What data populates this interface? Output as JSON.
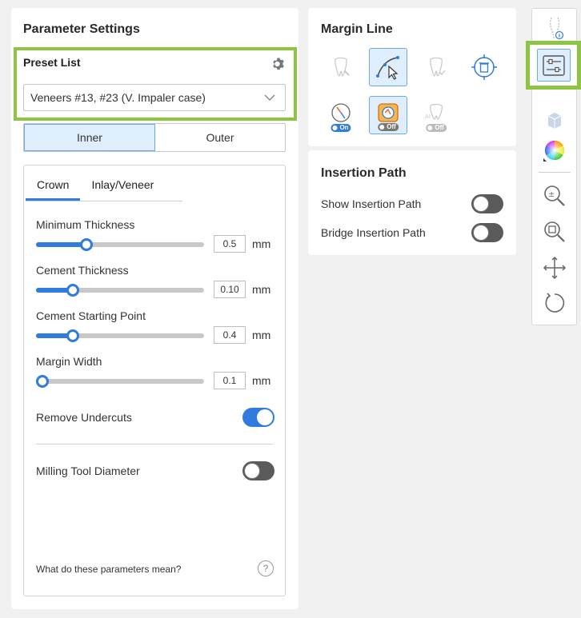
{
  "parameter_settings": {
    "title": "Parameter Settings",
    "preset": {
      "label": "Preset List",
      "selected": "Veneers #13, #23 (V. Impaler case)"
    },
    "side_tabs": [
      "Inner",
      "Outer"
    ],
    "active_side_tab": "Inner",
    "sub_tabs": [
      "Crown",
      "Inlay/Veneer"
    ],
    "active_sub_tab": "Crown",
    "params": [
      {
        "label": "Minimum Thickness",
        "value": "0.5",
        "unit": "mm",
        "fraction": 0.3
      },
      {
        "label": "Cement Thickness",
        "value": "0.10",
        "unit": "mm",
        "fraction": 0.22
      },
      {
        "label": "Cement Starting Point",
        "value": "0.4",
        "unit": "mm",
        "fraction": 0.22
      },
      {
        "label": "Margin Width",
        "value": "0.1",
        "unit": "mm",
        "fraction": 0.04
      }
    ],
    "remove_undercuts": {
      "label": "Remove Undercuts",
      "state": "on"
    },
    "milling_tool": {
      "label": "Milling Tool Diameter",
      "state": "off"
    },
    "help_text": "What do these parameters mean?",
    "help_icon_glyph": "?"
  },
  "margin_line": {
    "title": "Margin Line",
    "tools": [
      {
        "icon": "tooth-brush-icon",
        "state": "disabled"
      },
      {
        "icon": "curve-pointer-icon",
        "state": "selected"
      },
      {
        "icon": "tooth-auto-icon",
        "state": "disabled"
      },
      {
        "icon": "target-delete-icon",
        "state": "normal"
      },
      {
        "icon": "compass-icon",
        "state": "normal",
        "badge": "On"
      },
      {
        "icon": "map-view-icon",
        "state": "selected",
        "badge": "Off"
      },
      {
        "icon": "tooth-ai-icon",
        "state": "disabled",
        "badge": "Off"
      }
    ]
  },
  "insertion_path": {
    "title": "Insertion Path",
    "items": [
      {
        "label": "Show Insertion Path",
        "state": "off"
      },
      {
        "label": "Bridge Insertion Path",
        "state": "off"
      }
    ]
  },
  "right_toolbar": {
    "items": [
      "tooth-info-icon",
      "parameter-settings-icon",
      "cube-view-icon",
      "color-wheel-icon",
      "zoom-fit-icon",
      "zoom-search-icon",
      "pan-icon",
      "rotate-icon"
    ]
  },
  "colors": {
    "accent": "#2f7be0",
    "highlight_green": "#8cc53f",
    "selected_bg": "#dfeefc"
  }
}
